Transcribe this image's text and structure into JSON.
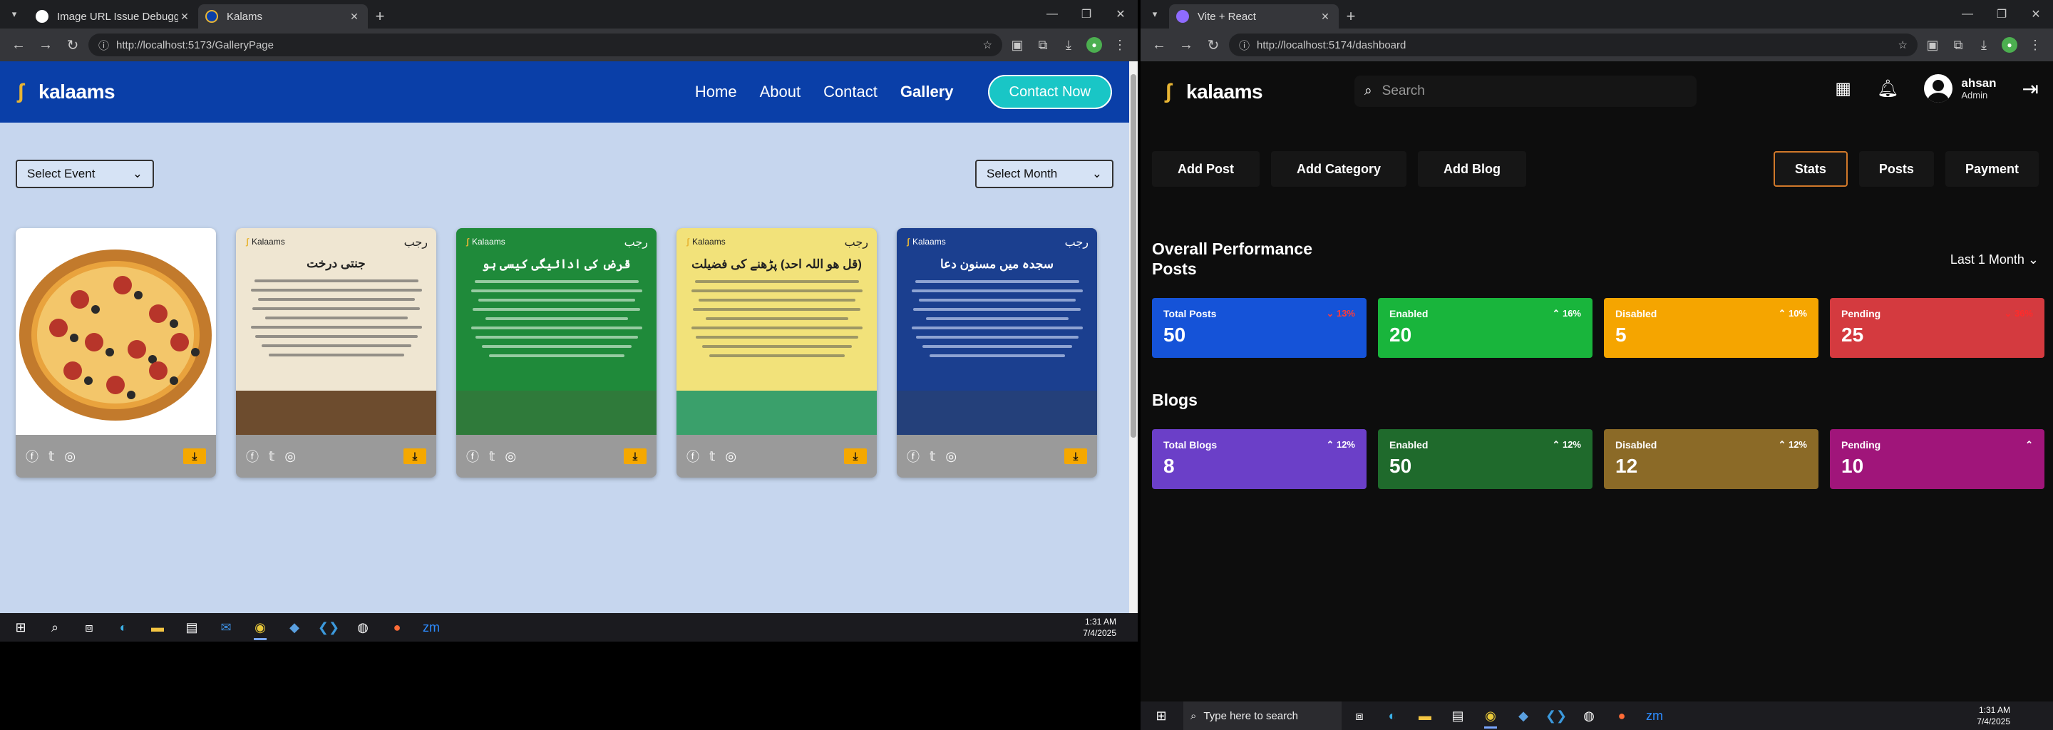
{
  "left": {
    "tabs": [
      {
        "title": "Image URL Issue Debugging",
        "active": false
      },
      {
        "title": "Kalams",
        "active": true
      }
    ],
    "url": "http://localhost:5173/GalleryPage",
    "site": {
      "logo": "kalaams",
      "nav": [
        "Home",
        "About",
        "Contact",
        "Gallery"
      ],
      "cta": "Contact Now"
    },
    "filters": {
      "event": "Select Event",
      "month": "Select Month"
    },
    "cards": [
      {
        "kind": "pizza",
        "title": ""
      },
      {
        "kind": "poster",
        "title": "جنتی درخت",
        "bg": "#efe6d2",
        "fg": "#222",
        "line": "#555",
        "ground": "#6d4c2e"
      },
      {
        "kind": "poster",
        "title": "قرض کی ادائیگی کیسی ہو",
        "bg": "#1f8a3a",
        "fg": "#fff",
        "line": "#e6f6e6",
        "ground": "#2f7a3a"
      },
      {
        "kind": "poster",
        "title": "(قل ھو اللہ احد) پڑھنے کی فضیلت",
        "bg": "#f2e27a",
        "fg": "#222",
        "line": "#665",
        "ground": "#3aa06b"
      },
      {
        "kind": "poster",
        "title": "سجدہ میں مسنون دعا",
        "bg": "#1b3f8f",
        "fg": "#fff",
        "line": "#dce6ff",
        "ground": "#24407a"
      }
    ],
    "poster_brand": "Kalaams",
    "poster_corner": "رجب",
    "card_icons": [
      "facebook-icon",
      "twitter-icon",
      "instagram-icon",
      "download-icon"
    ],
    "clock": {
      "time": "1:31 AM",
      "date": "7/4/2025"
    }
  },
  "right": {
    "tab": {
      "title": "Vite + React"
    },
    "url": "http://localhost:5174/dashboard",
    "logo": "kalaams",
    "search_placeholder": "Search",
    "user": {
      "name": "ahsan",
      "role": "Admin"
    },
    "left_tabs": [
      "Add Post",
      "Add Category",
      "Add Blog"
    ],
    "right_tabs": [
      "Stats",
      "Posts",
      "Payment"
    ],
    "overall_title": "Overall Performance",
    "posts_title": "Posts",
    "blogs_title": "Blogs",
    "period": "Last 1 Month",
    "posts_stats": [
      {
        "label": "Total Posts",
        "value": "50",
        "change": "13%",
        "dir": "down",
        "color": "#1553d8",
        "chg_color": "#ff3b3b"
      },
      {
        "label": "Enabled",
        "value": "20",
        "change": "16%",
        "dir": "up",
        "color": "#19b53c",
        "chg_color": "#ffffff"
      },
      {
        "label": "Disabled",
        "value": "5",
        "change": "10%",
        "dir": "up",
        "color": "#f5a500",
        "chg_color": "#ffffff"
      },
      {
        "label": "Pending",
        "value": "25",
        "change": "36%",
        "dir": "down",
        "color": "#d43a3f",
        "chg_color": "#ff2b2b"
      }
    ],
    "blogs_stats": [
      {
        "label": "Total Blogs",
        "value": "8",
        "change": "12%",
        "dir": "up",
        "color": "#6b3fc8",
        "chg_color": "#ffffff"
      },
      {
        "label": "Enabled",
        "value": "50",
        "change": "12%",
        "dir": "up",
        "color": "#1f6a2c",
        "chg_color": "#ffffff"
      },
      {
        "label": "Disabled",
        "value": "12",
        "change": "12%",
        "dir": "up",
        "color": "#8b6a27",
        "chg_color": "#ffffff"
      },
      {
        "label": "Pending",
        "value": "10",
        "change": "",
        "dir": "up",
        "color": "#a0157a",
        "chg_color": "#ffffff"
      }
    ],
    "taskbar_search": "Type here to search",
    "clock": {
      "time": "1:31 AM",
      "date": "7/4/2025"
    }
  }
}
